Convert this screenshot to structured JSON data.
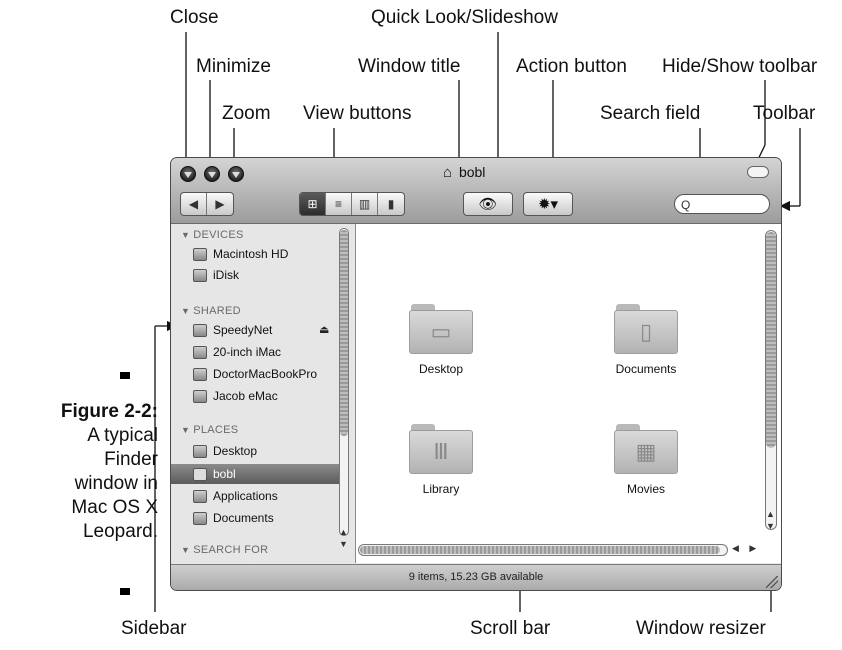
{
  "callouts": {
    "close": "Close",
    "minimize": "Minimize",
    "zoom": "Zoom",
    "quick_look": "Quick Look/Slideshow",
    "window_title": "Window title",
    "view_buttons": "View buttons",
    "action_button": "Action button",
    "hide_show_toolbar": "Hide/Show toolbar",
    "search_field": "Search field",
    "toolbar": "Toolbar",
    "sidebar": "Sidebar",
    "scroll_bar": "Scroll bar",
    "window_resizer": "Window resizer"
  },
  "caption": {
    "figure": "Figure 2-2:",
    "lines": [
      "A typical",
      "Finder",
      "window in",
      "Mac OS X",
      "Leopard."
    ]
  },
  "window": {
    "title": "bobl",
    "title_icon": "house-icon",
    "toolbar": {
      "back": "◀",
      "forward": "▶",
      "view_icon": "⊞",
      "view_list": "≡",
      "view_columns": "▥",
      "view_coverflow": "▮",
      "quick_look": "👁",
      "action": "✹▾",
      "search_placeholder": "Q"
    },
    "sidebar": {
      "devices": {
        "heading": "DEVICES",
        "items": [
          "Macintosh HD",
          "iDisk"
        ]
      },
      "shared": {
        "heading": "SHARED",
        "items": [
          "SpeedyNet",
          "20-inch iMac",
          "DoctorMacBookPro",
          "Jacob eMac"
        ]
      },
      "places": {
        "heading": "PLACES",
        "items": [
          "Desktop",
          "bobl",
          "Applications",
          "Documents"
        ]
      },
      "search_for": {
        "heading": "SEARCH FOR"
      },
      "eject": "⏏"
    },
    "files": [
      "Desktop",
      "Documents",
      "Library",
      "Movies"
    ],
    "status": "9 items, 15.23 GB available"
  },
  "colors": {
    "sidebar_selected": "#6b6b6b",
    "titlebar": "#b8b8b8"
  }
}
